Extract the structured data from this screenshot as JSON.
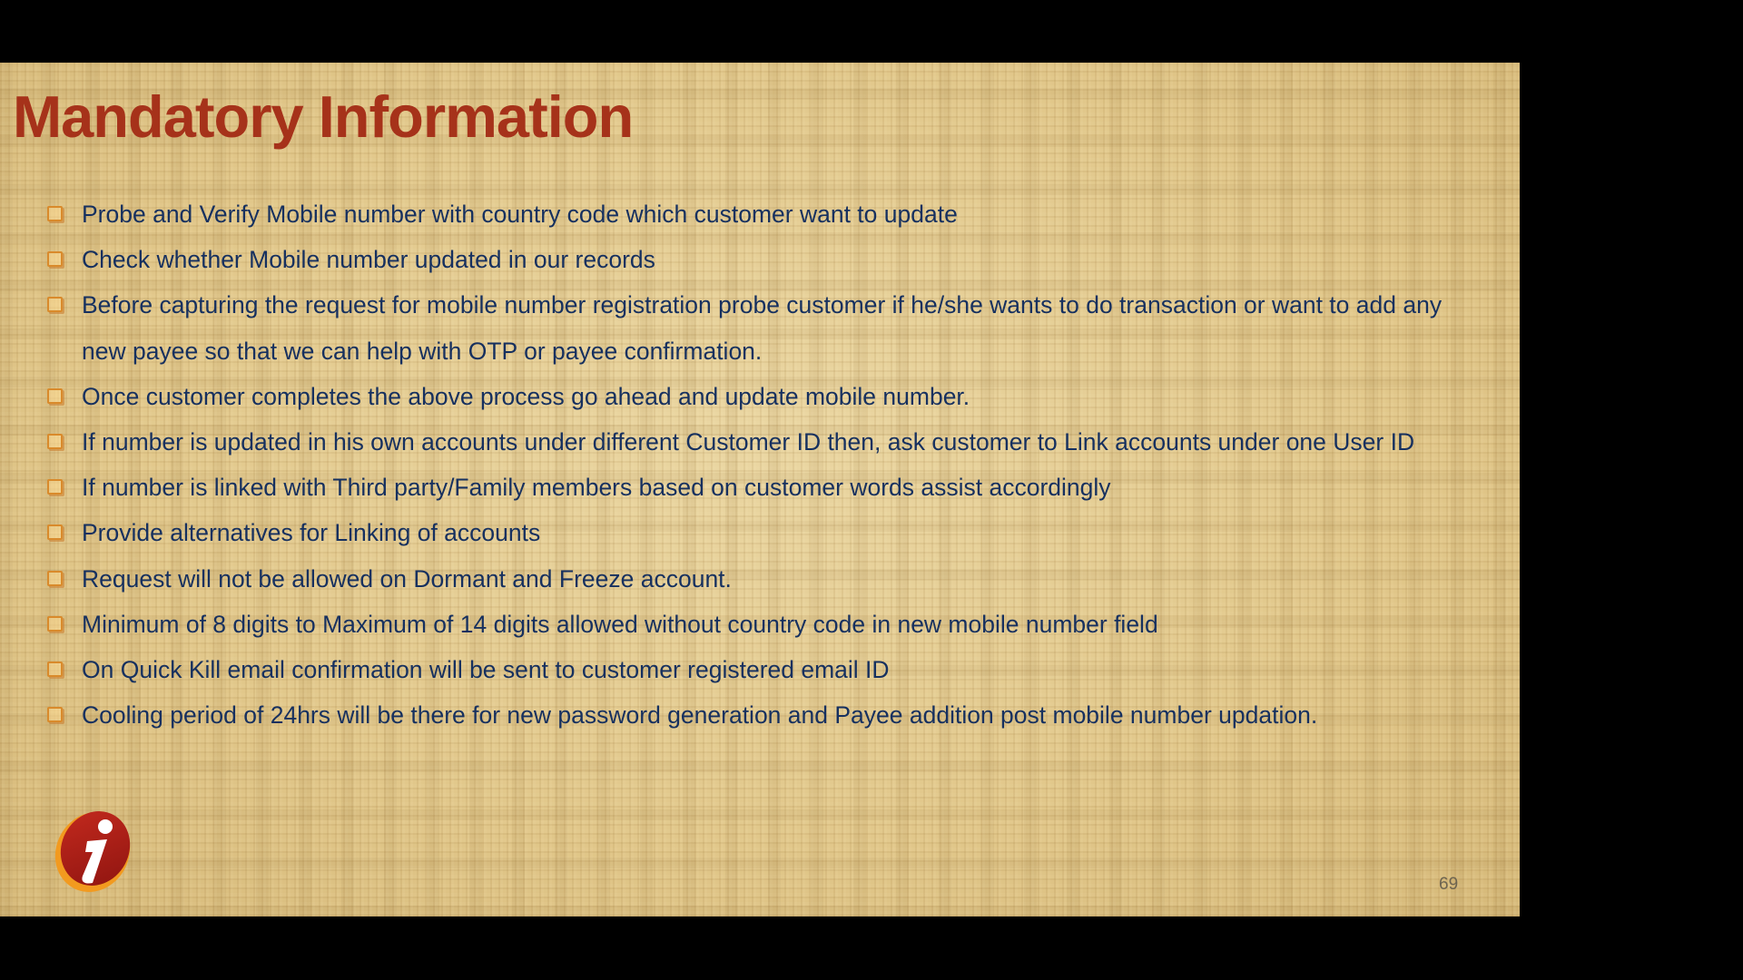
{
  "slide": {
    "title": "Mandatory Information",
    "bullets": [
      "Probe and Verify Mobile number with country code which customer want to update",
      "Check whether Mobile number updated in our records",
      "Before capturing the request for mobile number registration probe customer if he/she wants to do transaction or want to add any new payee so that we can help with OTP or payee confirmation.",
      "Once customer completes the above process go ahead and update mobile number.",
      "If number is updated in his own accounts under different Customer ID then, ask customer to Link accounts under one User ID",
      "If number is linked with Third party/Family members based on customer words assist accordingly",
      "Provide alternatives for Linking of accounts",
      "Request will not be allowed on Dormant and Freeze account.",
      "Minimum of 8 digits to Maximum of 14 digits allowed without country code in new mobile number field",
      "On Quick Kill email confirmation will be sent to customer registered email ID",
      "Cooling period of 24hrs will be there for new password generation and Payee addition post mobile number updation."
    ],
    "page_number": "69",
    "logo_icon": "icici-bank-logo"
  },
  "colors": {
    "title": "#a6321a",
    "body_text": "#16305f",
    "bullet": "#d98a2b",
    "background": "#e2c98c",
    "screen": "#000000"
  }
}
